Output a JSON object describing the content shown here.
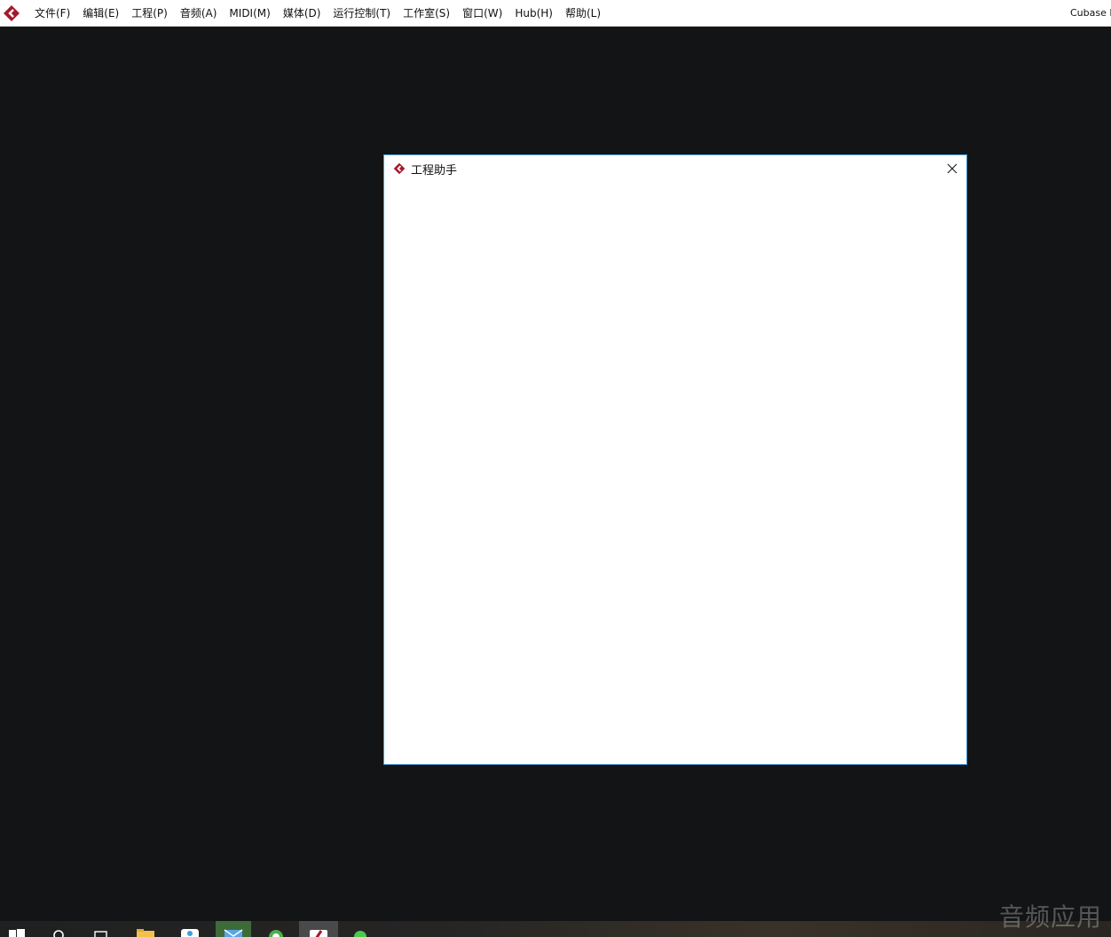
{
  "menubar": {
    "items": [
      {
        "label": "文件(F)"
      },
      {
        "label": "编辑(E)"
      },
      {
        "label": "工程(P)"
      },
      {
        "label": "音频(A)"
      },
      {
        "label": "MIDI(M)"
      },
      {
        "label": "媒体(D)"
      },
      {
        "label": "运行控制(T)"
      },
      {
        "label": "工作室(S)"
      },
      {
        "label": "窗口(W)"
      },
      {
        "label": "Hub(H)"
      },
      {
        "label": "帮助(L)"
      }
    ],
    "app_title": "Cubase E"
  },
  "dialog": {
    "title": "工程助手"
  },
  "watermark": "音频应用",
  "colors": {
    "workspace": "#131416",
    "dialog_border": "#4a9fd8",
    "cubase_red": "#a5192a"
  }
}
